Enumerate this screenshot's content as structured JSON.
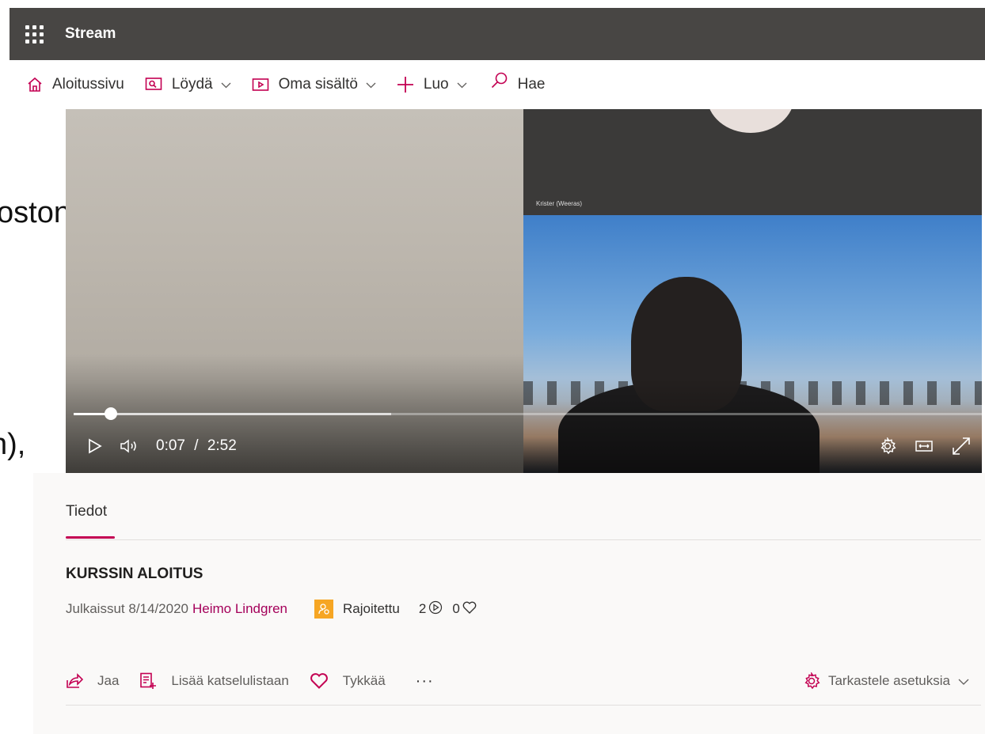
{
  "app": {
    "name": "Stream"
  },
  "nav": {
    "items": [
      {
        "label": "Aloitussivu",
        "icon": "home-icon",
        "dropdown": false
      },
      {
        "label": "Löydä",
        "icon": "discover-icon",
        "dropdown": true
      },
      {
        "label": "Oma sisältö",
        "icon": "my-content-icon",
        "dropdown": true
      },
      {
        "label": "Luo",
        "icon": "plus-icon",
        "dropdown": true
      },
      {
        "label": "Hae",
        "icon": "search-icon",
        "dropdown": false
      }
    ]
  },
  "background_text": {
    "line1": "ostona.",
    "line2": "n),"
  },
  "video": {
    "speaker_label": "Krister (Weeras)",
    "current_time": "0:07",
    "duration": "2:52",
    "time_separator": "/",
    "progress_fraction": 0.041,
    "buffered_fraction": 0.35
  },
  "info": {
    "tab_label": "Tiedot",
    "title": "KURSSIN ALOITUS",
    "published_prefix": "Julkaissut 8/14/2020",
    "author": "Heimo Lindgren",
    "permission": "Rajoitettu",
    "views": "2",
    "likes": "0",
    "actions": {
      "share": "Jaa",
      "add_to_watchlist": "Lisää katselulistaan",
      "like": "Tykkää",
      "more": "···"
    },
    "view_settings": "Tarkastele asetuksia"
  },
  "colors": {
    "appbar": "#484644",
    "accent": "#c30052",
    "badge": "#f6a623",
    "panel": "#faf9f8"
  }
}
